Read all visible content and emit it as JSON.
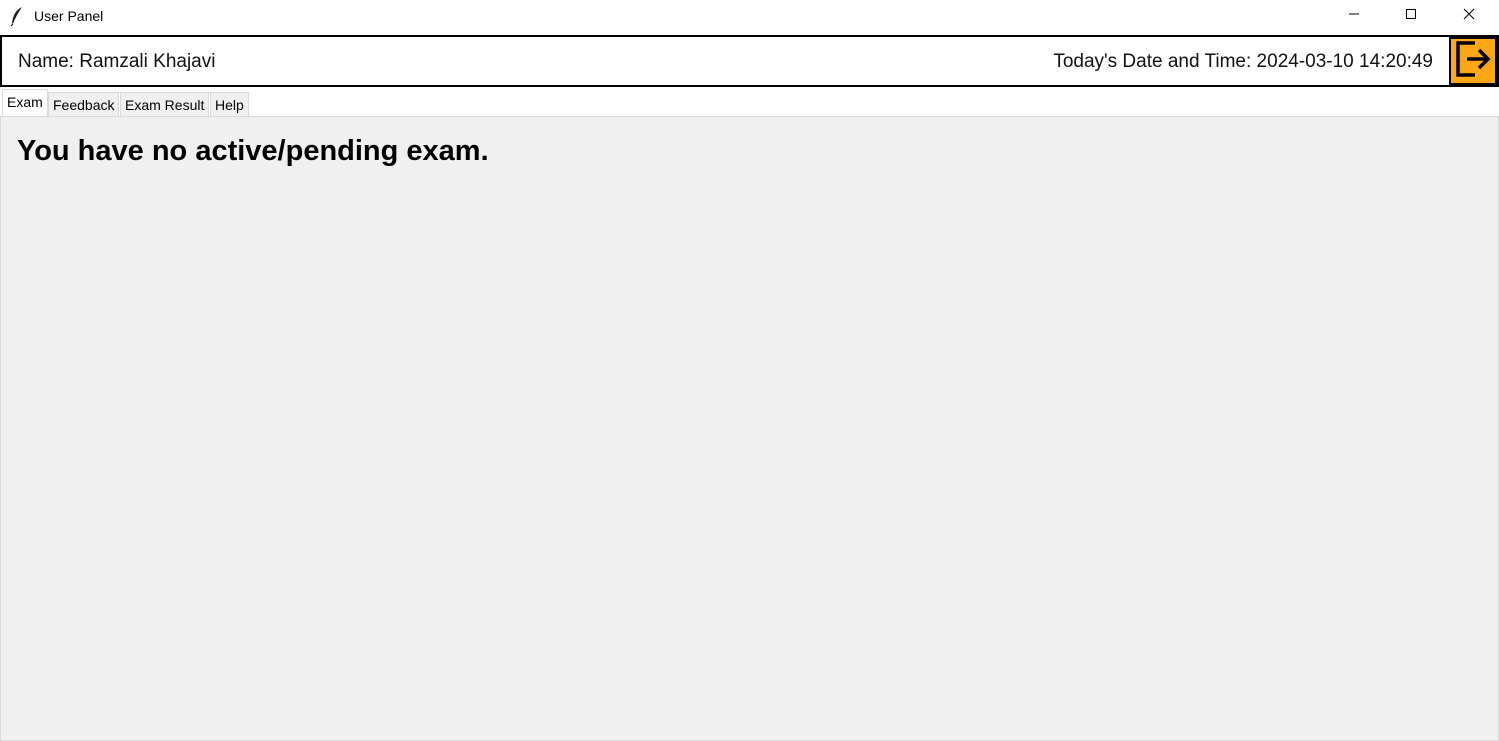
{
  "window": {
    "title": "User Panel",
    "app_icon": "feather-icon",
    "controls": [
      "minimize-icon",
      "maximize-icon",
      "close-icon"
    ]
  },
  "header": {
    "name_text": "Name: Ramzali Khajavi",
    "datetime_text": "Today's Date and Time: 2024-03-10 14:20:49",
    "logout_icon": "logout-icon",
    "logout_color": "#fca716"
  },
  "tabs": [
    {
      "label": "Exam",
      "active": true
    },
    {
      "label": "Feedback",
      "active": false
    },
    {
      "label": "Exam Result",
      "active": false
    },
    {
      "label": "Help",
      "active": false
    }
  ],
  "main": {
    "message": "You have no active/pending exam."
  }
}
